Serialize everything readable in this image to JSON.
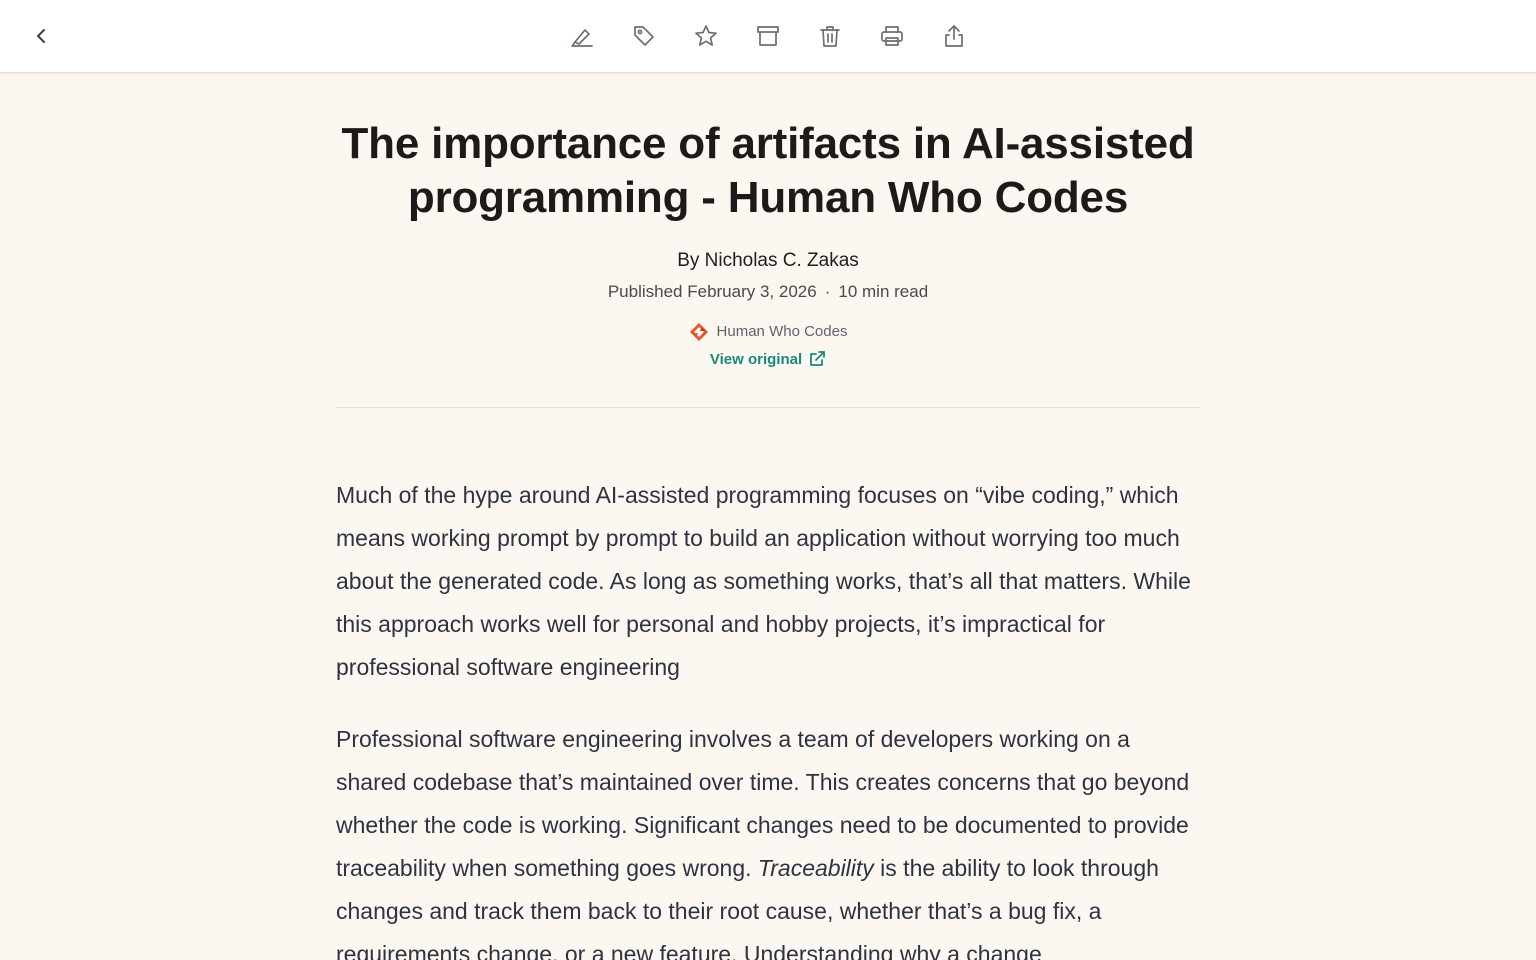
{
  "toolbar": {
    "back_icon": "chevron-left-icon",
    "actions": [
      {
        "name": "highlight-button",
        "icon": "highlighter-icon"
      },
      {
        "name": "tag-button",
        "icon": "tag-icon"
      },
      {
        "name": "favorite-button",
        "icon": "star-icon"
      },
      {
        "name": "archive-button",
        "icon": "archive-icon"
      },
      {
        "name": "delete-button",
        "icon": "trash-icon"
      },
      {
        "name": "print-button",
        "icon": "printer-icon"
      },
      {
        "name": "share-button",
        "icon": "share-icon"
      }
    ]
  },
  "article": {
    "title": "The importance of artifacts in AI-assisted programming - Human Who Codes",
    "byline": "By Nicholas C. Zakas",
    "published": "Published February 3, 2026",
    "separator": "·",
    "read_time": "10 min read",
    "source_name": "Human Who Codes",
    "view_original": "View original",
    "paragraph1": "Much of the hype around AI-assisted programming focuses on “vibe coding,” which means working prompt by prompt to build an application without worrying too much about the generated code. As long as something works, that’s all that matters. While this approach works well for personal and hobby projects, it’s impractical for professional software engineering",
    "paragraph2_before": "Professional software engineering involves a team of developers working on a shared codebase that’s maintained over time. This creates concerns that go beyond whether the code is working. Significant changes need to be documented to provide traceability when something goes wrong. ",
    "paragraph2_em": "Traceability",
    "paragraph2_after": " is the ability to look through changes and track them back to their root cause, whether that’s a bug fix, a requirements change, or a new feature. Understanding why a change"
  },
  "colors": {
    "background": "#fdf7f2",
    "toolbar": "#ffffff",
    "link": "#1a8a78",
    "logo": "#e2572b"
  }
}
